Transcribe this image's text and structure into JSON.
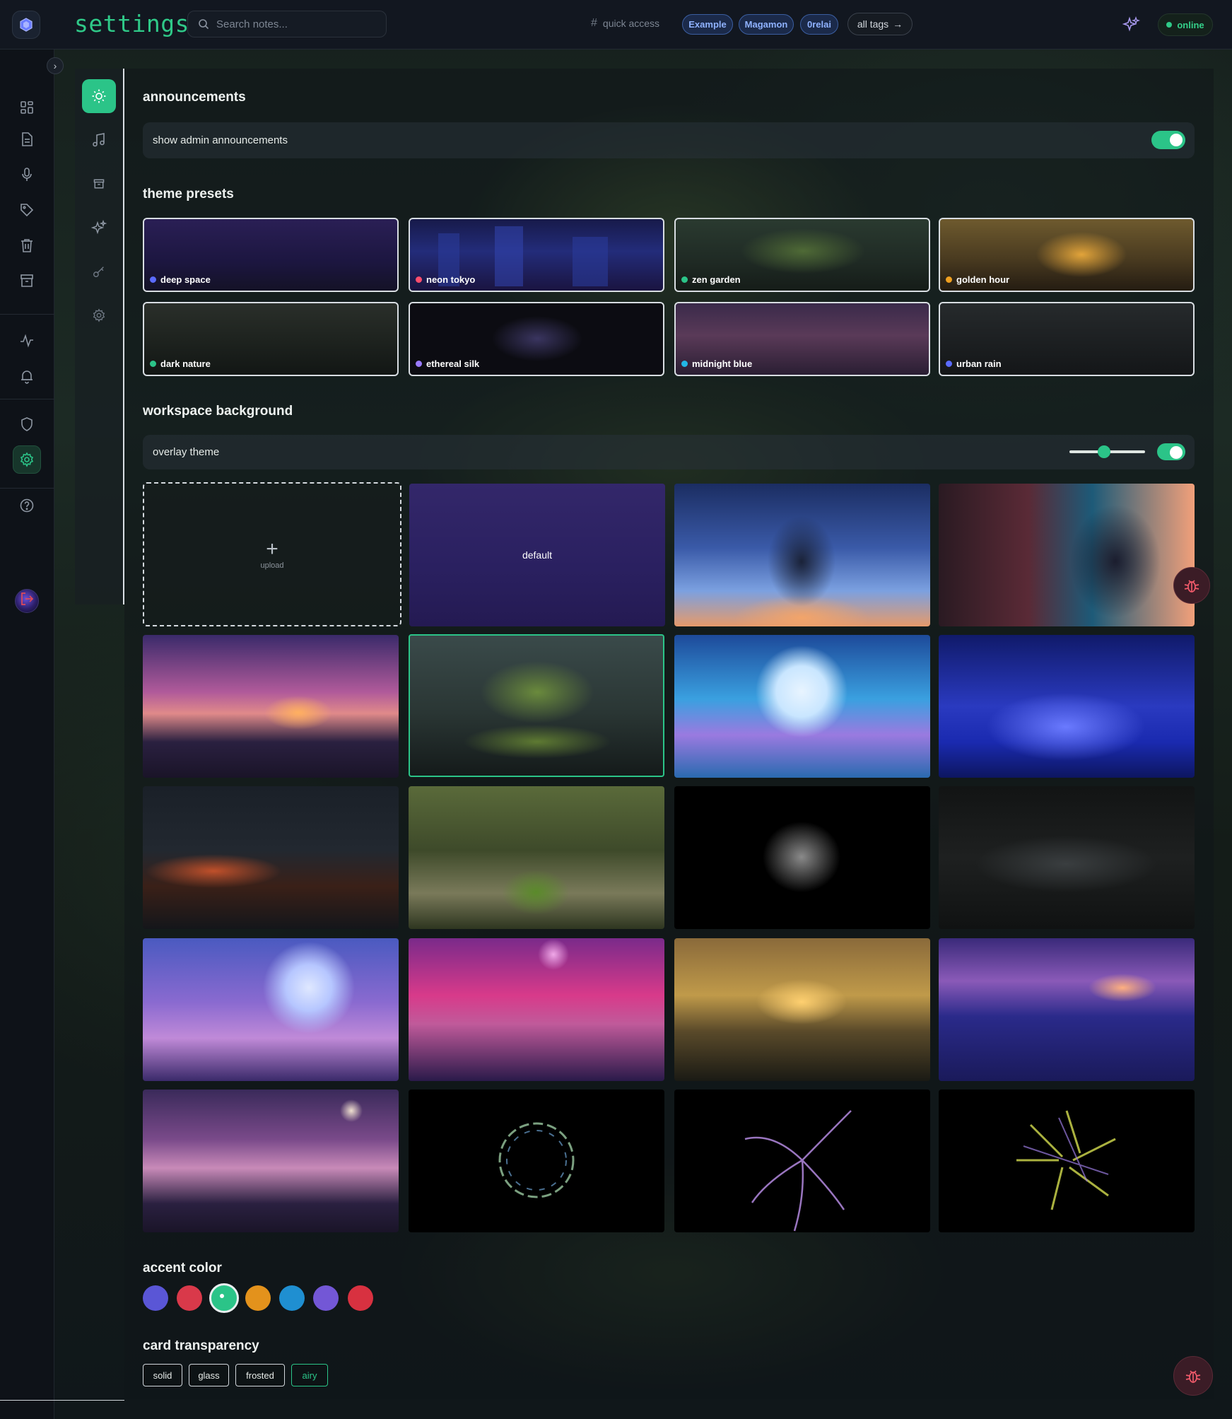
{
  "app": {
    "page_title": "settings"
  },
  "search": {
    "placeholder": "Search notes..."
  },
  "quick_access": {
    "label": "quick access",
    "tags": [
      "Example",
      "Magamon",
      "0relai"
    ],
    "all_tags_label": "all tags"
  },
  "status": {
    "label": "online",
    "color": "#2fc988"
  },
  "sidebar": {
    "items": [
      "dashboard-icon",
      "notes-icon",
      "microphone-icon",
      "tag-icon",
      "trash-icon",
      "archive-icon",
      "activity-icon",
      "bell-icon",
      "shield-icon",
      "settings-icon",
      "help-icon",
      "avatar",
      "logout-icon"
    ],
    "active": "settings-icon"
  },
  "subnav": {
    "items": [
      "sun-icon",
      "music-icon",
      "archive-icon",
      "sparkle-icon",
      "key-icon",
      "gear-icon"
    ],
    "active": "sun-icon"
  },
  "announcements": {
    "heading": "announcements",
    "row_label": "show admin announcements",
    "enabled": true
  },
  "theme_presets": {
    "heading": "theme presets",
    "items": [
      {
        "label": "deep space",
        "dot": "#5b6bff"
      },
      {
        "label": "neon tokyo",
        "dot": "#ff4d6d"
      },
      {
        "label": "zen garden",
        "dot": "#2bc488"
      },
      {
        "label": "golden hour",
        "dot": "#f0a020"
      },
      {
        "label": "dark nature",
        "dot": "#2bc488"
      },
      {
        "label": "ethereal silk",
        "dot": "#9a7bff"
      },
      {
        "label": "midnight blue",
        "dot": "#22b8e6"
      },
      {
        "label": "urban rain",
        "dot": "#5b6bff"
      }
    ]
  },
  "workspace_background": {
    "heading": "workspace background",
    "overlay_label": "overlay theme",
    "overlay_enabled": true,
    "overlay_level": 0.45,
    "upload_label": "upload",
    "default_label": "default",
    "selected_index": 5
  },
  "accent_color": {
    "heading": "accent color",
    "colors": [
      "#5a56d6",
      "#d9394a",
      "#2bc488",
      "#e3921c",
      "#1f8fd1",
      "#7357d6",
      "#d83140"
    ],
    "selected_index": 2
  },
  "card_transparency": {
    "heading": "card transparency",
    "options": [
      "solid",
      "glass",
      "frosted",
      "airy"
    ],
    "selected": "airy"
  }
}
